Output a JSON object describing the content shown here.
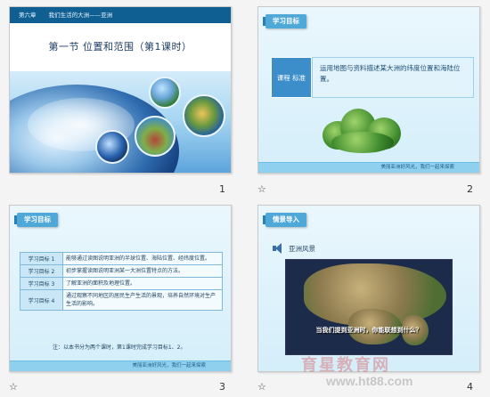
{
  "slides": [
    {
      "number": "1",
      "header": {
        "chapter": "第六章",
        "chapter_title": "我们生活的大洲——亚洲"
      },
      "title": "第一节   位置和范围（第1课时）"
    },
    {
      "number": "2",
      "tag": "学习目标",
      "standard_label": "课程 标准",
      "standard_text": "运用地图与资料描述某大洲的纬度位置和海陆位置。",
      "footer": "美丽亚洲好风光，我们一起来探索"
    },
    {
      "number": "3",
      "tag": "学习目标",
      "goals": [
        {
          "label": "学习目标 1",
          "text": "能够通过读图说明亚洲的半球位置、海陆位置、经纬度位置。"
        },
        {
          "label": "学习目标 2",
          "text": "初步掌握读图说明亚洲某一大洲位置特点的方法。"
        },
        {
          "label": "学习目标 3",
          "text": "了解亚洲的面积及地理位置。"
        },
        {
          "label": "学习目标 4",
          "text": "通过观察不同地区的居民生产生活的景观，培养自然环境对生产生活的影响。"
        }
      ],
      "note": "注：以本书分为两个课时，第1课时完成学习目标1、2。",
      "footer": "美丽亚洲好风光，我们一起来探索"
    },
    {
      "number": "4",
      "tag": "情景导入",
      "subtitle": "亚洲风景",
      "caption": "当我们提到亚洲时，你能联想到什么？"
    }
  ],
  "markers": {
    "star": "☆"
  },
  "watermark": {
    "text": "育星教育网",
    "url": "www.ht88.com"
  },
  "colors": {
    "accent": "#4ea8d8",
    "header_blue": "#0f5f93",
    "footer_band": "#8fd0ef"
  }
}
